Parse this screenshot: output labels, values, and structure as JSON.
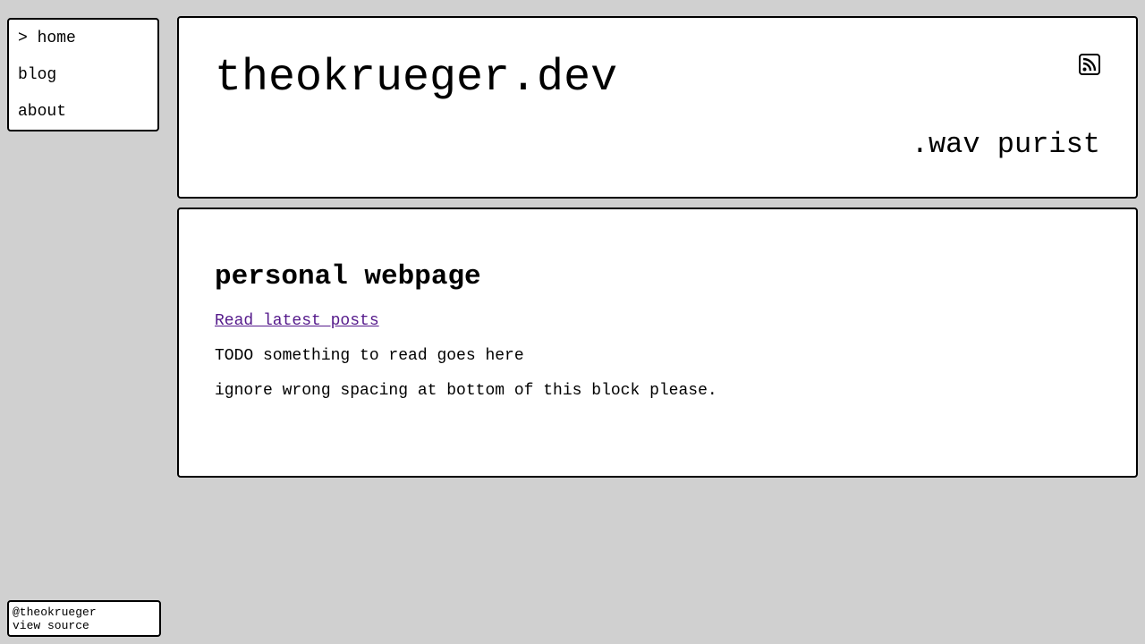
{
  "nav": {
    "items": [
      {
        "label": "> home"
      },
      {
        "label": "blog"
      },
      {
        "label": "about"
      }
    ]
  },
  "header": {
    "title": "theokrueger.dev",
    "tagline": ".wav purist",
    "feed_icon": "rss-icon"
  },
  "main": {
    "heading": "personal webpage",
    "link_text": "Read latest posts",
    "paragraphs": [
      "TODO something to read goes here",
      "ignore wrong spacing at bottom of this block please."
    ]
  },
  "footer": {
    "handle": "@theokrueger",
    "source_link": "view source"
  },
  "colors": {
    "background": "#d0d0d0",
    "panel": "#ffffff",
    "border": "#000000",
    "visited_link": "#551a8b"
  }
}
